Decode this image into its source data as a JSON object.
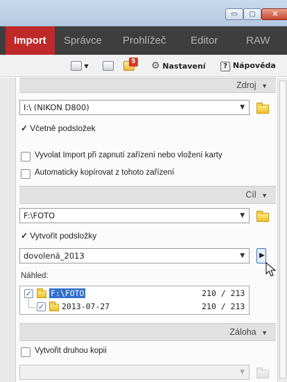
{
  "window": {
    "min_glyph": "▭",
    "max_glyph": "▢",
    "close_glyph": "✕"
  },
  "tabs": [
    "Import",
    "Správce",
    "Prohlížeč",
    "Editor",
    "RAW"
  ],
  "toolbar": {
    "badge_count": "5",
    "settings_label": "Nastavení",
    "help_label": "Nápověda"
  },
  "source": {
    "header": "Zdroj",
    "device": "I:\\ (NIKON D800)",
    "include_subfolders": "Včetně podsložek",
    "auto_import": "Vyvolat Import při zapnutí zařízení nebo vložení karty",
    "auto_copy": "Automaticky kopírovat z tohoto zařízení"
  },
  "target": {
    "header": "Cíl",
    "path": "F:\\FOTO",
    "create_subfolders": "Vytvořit podsložky",
    "subfolder_name": "dovolená_2013",
    "preview_label": "Náhled:",
    "tree": [
      {
        "name": "F:\\FOTO",
        "count": "210 / 213"
      },
      {
        "name": "2013-07-27",
        "count": "210 / 213"
      }
    ]
  },
  "backup": {
    "header": "Záloha",
    "second_copy": "Vytvořit druhou kopii"
  }
}
